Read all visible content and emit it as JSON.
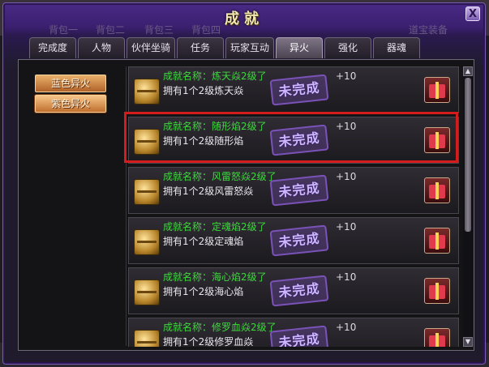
{
  "window": {
    "title": "成就",
    "close_label": "X",
    "background_tabs": [
      "背包一",
      "背包二",
      "背包三",
      "背包四",
      "道宝装备"
    ]
  },
  "tabs": [
    {
      "label": "完成度",
      "active": false
    },
    {
      "label": "人物",
      "active": false
    },
    {
      "label": "伙伴坐骑",
      "active": false
    },
    {
      "label": "任务",
      "active": false
    },
    {
      "label": "玩家互动",
      "active": false
    },
    {
      "label": "异火",
      "active": true
    },
    {
      "label": "强化",
      "active": false
    },
    {
      "label": "器魂",
      "active": false
    }
  ],
  "sidebar": {
    "items": [
      {
        "label": "蓝色异火",
        "active": false
      },
      {
        "label": "紫色异火",
        "active": true
      }
    ]
  },
  "achievements": [
    {
      "name": "成就名称：炼天焱2级了",
      "desc": "拥有1个2级炼天焱",
      "status": "未完成",
      "reward": "+10",
      "icon": "treasure-chest-icon",
      "reward_icon": "gift-box-icon"
    },
    {
      "name": "成就名称：随形焰2级了",
      "desc": "拥有1个2级随形焰",
      "status": "未完成",
      "reward": "+10",
      "icon": "treasure-chest-icon",
      "reward_icon": "gift-box-icon"
    },
    {
      "name": "成就名称：风雷怒焱2级了",
      "desc": "拥有1个2级风雷怒焱",
      "status": "未完成",
      "reward": "+10",
      "icon": "treasure-chest-icon",
      "reward_icon": "gift-box-icon"
    },
    {
      "name": "成就名称：定魂焰2级了",
      "desc": "拥有1个2级定魂焰",
      "status": "未完成",
      "reward": "+10",
      "icon": "treasure-chest-icon",
      "reward_icon": "gift-box-icon"
    },
    {
      "name": "成就名称：海心焰2级了",
      "desc": "拥有1个2级海心焰",
      "status": "未完成",
      "reward": "+10",
      "icon": "treasure-chest-icon",
      "reward_icon": "gift-box-icon"
    },
    {
      "name": "成就名称：修罗血焱2级了",
      "desc": "拥有1个2级修罗血焱",
      "status": "未完成",
      "reward": "+10",
      "icon": "treasure-chest-icon",
      "reward_icon": "gift-box-icon"
    }
  ],
  "scrollbar": {
    "up": "▲",
    "down": "▼"
  },
  "colors": {
    "achievement_name": "#3fd83f",
    "highlight_border": "#d41c1c",
    "stamp": "#7a52b8",
    "sidebar_button": "#c0702e"
  }
}
